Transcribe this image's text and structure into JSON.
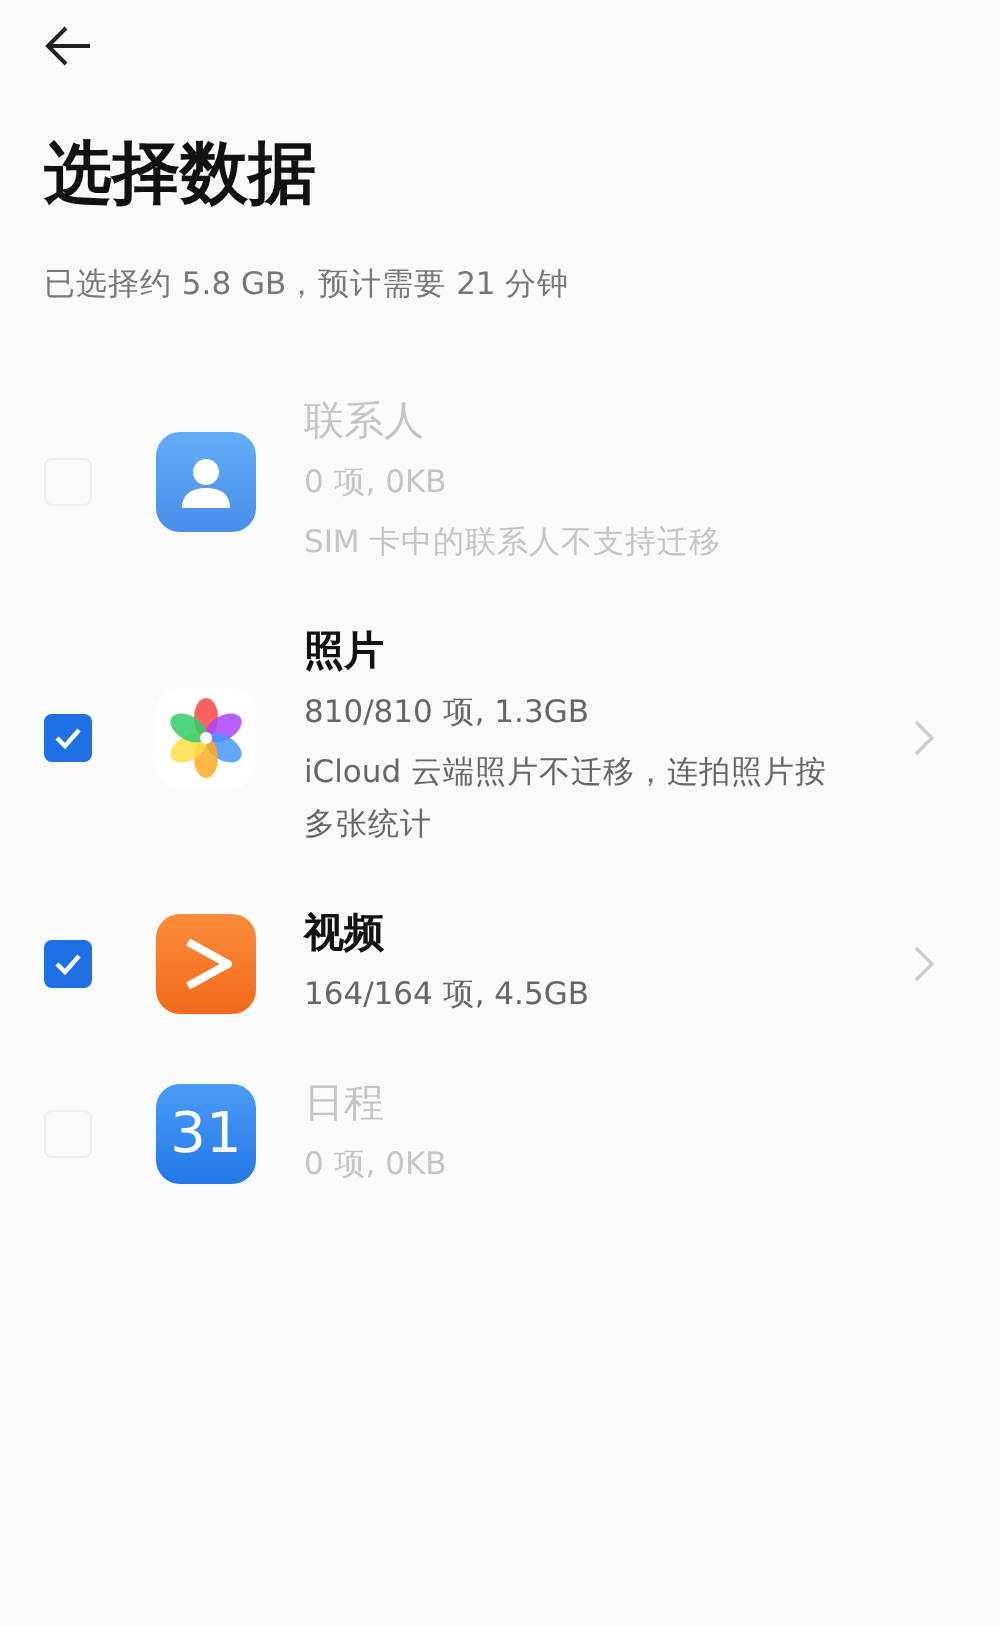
{
  "title": "选择数据",
  "summary": "已选择约 5.8 GB，预计需要 21 分钟",
  "items": [
    {
      "kind": "contacts",
      "name": "联系人",
      "count": "0 项, 0KB",
      "note": "SIM 卡中的联系人不支持迁移",
      "checked": false,
      "disabled": true,
      "chevron": false
    },
    {
      "kind": "photos",
      "name": "照片",
      "count": "810/810 项, 1.3GB",
      "note": "iCloud 云端照片不迁移，连拍照片按多张统计",
      "checked": true,
      "disabled": false,
      "chevron": true
    },
    {
      "kind": "videos",
      "name": "视频",
      "count": "164/164 项, 4.5GB",
      "checked": true,
      "disabled": false,
      "chevron": true
    },
    {
      "kind": "calendar",
      "name": "日程",
      "count": "0 项, 0KB",
      "icon_text": "31",
      "checked": false,
      "disabled": true,
      "chevron": false
    }
  ]
}
